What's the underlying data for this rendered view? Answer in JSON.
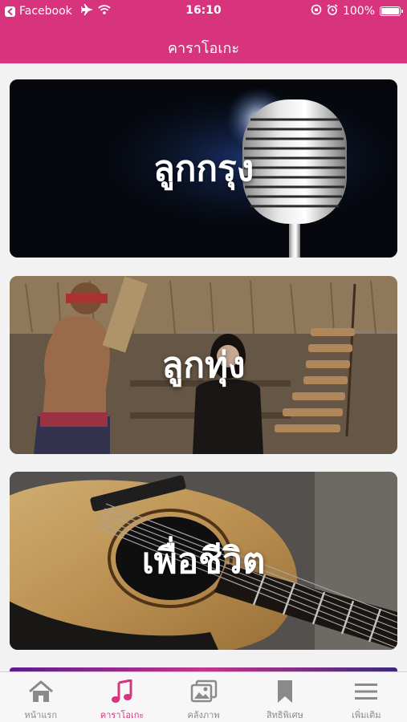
{
  "status_bar": {
    "back_app": "Facebook",
    "time": "16:10",
    "battery": "100%",
    "battery_level": 1.0
  },
  "nav": {
    "title": "คาราโอเกะ"
  },
  "cards": [
    {
      "label": "ลูกกรุง",
      "image": "vintage-microphone"
    },
    {
      "label": "ลูกทุ่ง",
      "image": "thai-folk-musicians"
    },
    {
      "label": "เพื่อชีวิต",
      "image": "acoustic-guitar"
    }
  ],
  "tabbar": {
    "active_color": "#d8347e",
    "items": [
      {
        "label": "หน้าแรก",
        "icon": "home-icon",
        "active": false
      },
      {
        "label": "คาราโอเกะ",
        "icon": "music-note-icon",
        "active": true
      },
      {
        "label": "คลังภาพ",
        "icon": "photo-gallery-icon",
        "active": false
      },
      {
        "label": "สิทธิพิเศษ",
        "icon": "bookmark-icon",
        "active": false
      },
      {
        "label": "เพิ่มเติม",
        "icon": "menu-icon",
        "active": false
      }
    ]
  },
  "colors": {
    "brand": "#d8347e",
    "tab_inactive": "#8a8a8a"
  }
}
